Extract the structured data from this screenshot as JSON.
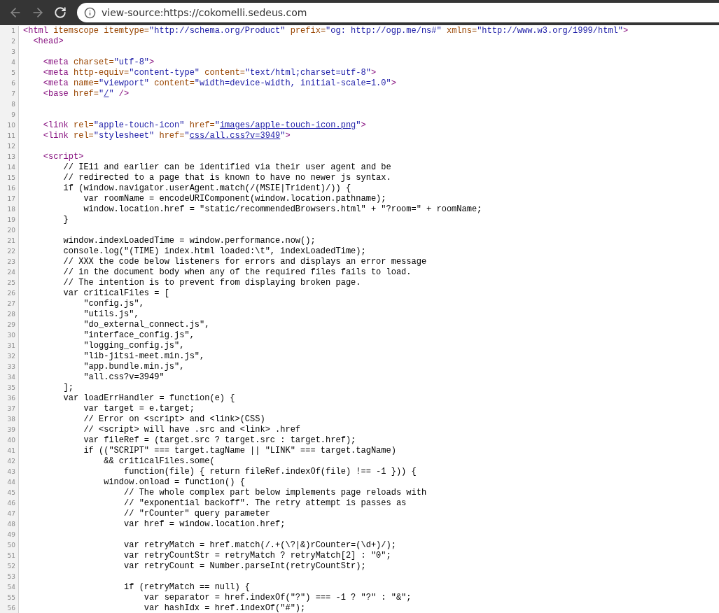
{
  "toolbar": {
    "back": {
      "disabled": true
    },
    "forward": {
      "disabled": true
    },
    "address_bar": {
      "value": "view-source:https://cokomelli.sedeus.com"
    }
  },
  "lines": [
    {
      "number": "1",
      "tokens": [
        {
          "kind": "tag",
          "text": "<html"
        },
        {
          "kind": "attr",
          "text": " itemscope itemtype="
        },
        {
          "kind": "value",
          "text": "\"http://schema.org/Product\""
        },
        {
          "kind": "attr",
          "text": " prefix="
        },
        {
          "kind": "value",
          "text": "\"og: http://ogp.me/ns#\""
        },
        {
          "kind": "attr",
          "text": " xmlns="
        },
        {
          "kind": "value",
          "text": "\"http://www.w3.org/1999/html\""
        },
        {
          "kind": "tag",
          "text": ">"
        }
      ]
    },
    {
      "number": "2",
      "tokens": [
        {
          "kind": "tag",
          "text": "  <head>"
        }
      ]
    },
    {
      "number": "3"
    },
    {
      "number": "4",
      "tokens": [
        {
          "kind": "tag",
          "text": "    <meta"
        },
        {
          "kind": "attr",
          "text": " charset="
        },
        {
          "kind": "value",
          "text": "\"utf-8\""
        },
        {
          "kind": "tag",
          "text": ">"
        }
      ]
    },
    {
      "number": "5",
      "tokens": [
        {
          "kind": "tag",
          "text": "    <meta"
        },
        {
          "kind": "attr",
          "text": " http-equiv="
        },
        {
          "kind": "value",
          "text": "\"content-type\""
        },
        {
          "kind": "attr",
          "text": " content="
        },
        {
          "kind": "value",
          "text": "\"text/html;charset=utf-8\""
        },
        {
          "kind": "tag",
          "text": ">"
        }
      ]
    },
    {
      "number": "6",
      "tokens": [
        {
          "kind": "tag",
          "text": "    <meta"
        },
        {
          "kind": "attr",
          "text": " name="
        },
        {
          "kind": "value",
          "text": "\"viewport\""
        },
        {
          "kind": "attr",
          "text": " content="
        },
        {
          "kind": "value",
          "text": "\"width=device-width, initial-scale=1.0\""
        },
        {
          "kind": "tag",
          "text": ">"
        }
      ]
    },
    {
      "number": "7",
      "tokens": [
        {
          "kind": "tag",
          "text": "    <base"
        },
        {
          "kind": "attr",
          "text": " href="
        },
        {
          "kind": "value",
          "text": "\""
        },
        {
          "kind": "link",
          "text": "/"
        },
        {
          "kind": "value",
          "text": "\""
        },
        {
          "kind": "tag",
          "text": " />"
        }
      ]
    },
    {
      "number": "8"
    },
    {
      "number": "9"
    },
    {
      "number": "10",
      "tokens": [
        {
          "kind": "tag",
          "text": "    <link"
        },
        {
          "kind": "attr",
          "text": " rel="
        },
        {
          "kind": "value",
          "text": "\"apple-touch-icon\""
        },
        {
          "kind": "attr",
          "text": " href="
        },
        {
          "kind": "value",
          "text": "\""
        },
        {
          "kind": "link",
          "text": "images/apple-touch-icon.png"
        },
        {
          "kind": "value",
          "text": "\""
        },
        {
          "kind": "tag",
          "text": ">"
        }
      ]
    },
    {
      "number": "11",
      "tokens": [
        {
          "kind": "tag",
          "text": "    <link"
        },
        {
          "kind": "attr",
          "text": " rel="
        },
        {
          "kind": "value",
          "text": "\"stylesheet\""
        },
        {
          "kind": "attr",
          "text": " href="
        },
        {
          "kind": "value",
          "text": "\""
        },
        {
          "kind": "link",
          "text": "css/all.css?v=3949"
        },
        {
          "kind": "value",
          "text": "\""
        },
        {
          "kind": "tag",
          "text": ">"
        }
      ]
    },
    {
      "number": "12"
    },
    {
      "number": "13",
      "tokens": [
        {
          "kind": "tag",
          "text": "    <script>"
        }
      ]
    },
    {
      "number": "14",
      "tokens": [
        {
          "kind": "text",
          "text": "        // IE11 and earlier can be identified via their user agent and be"
        }
      ]
    },
    {
      "number": "15",
      "tokens": [
        {
          "kind": "text",
          "text": "        // redirected to a page that is known to have no newer js syntax."
        }
      ]
    },
    {
      "number": "16",
      "tokens": [
        {
          "kind": "text",
          "text": "        if (window.navigator.userAgent.match(/(MSIE|Trident)/)) {"
        }
      ]
    },
    {
      "number": "17",
      "tokens": [
        {
          "kind": "text",
          "text": "            var roomName = encodeURIComponent(window.location.pathname);"
        }
      ]
    },
    {
      "number": "18",
      "tokens": [
        {
          "kind": "text",
          "text": "            window.location.href = \"static/recommendedBrowsers.html\" + \"?room=\" + roomName;"
        }
      ]
    },
    {
      "number": "19",
      "tokens": [
        {
          "kind": "text",
          "text": "        }"
        }
      ]
    },
    {
      "number": "20"
    },
    {
      "number": "21",
      "tokens": [
        {
          "kind": "text",
          "text": "        window.indexLoadedTime = window.performance.now();"
        }
      ]
    },
    {
      "number": "22",
      "tokens": [
        {
          "kind": "text",
          "text": "        console.log(\"(TIME) index.html loaded:\\t\", indexLoadedTime);"
        }
      ]
    },
    {
      "number": "23",
      "tokens": [
        {
          "kind": "text",
          "text": "        // XXX the code below listeners for errors and displays an error message"
        }
      ]
    },
    {
      "number": "24",
      "tokens": [
        {
          "kind": "text",
          "text": "        // in the document body when any of the required files fails to load."
        }
      ]
    },
    {
      "number": "25",
      "tokens": [
        {
          "kind": "text",
          "text": "        // The intention is to prevent from displaying broken page."
        }
      ]
    },
    {
      "number": "26",
      "tokens": [
        {
          "kind": "text",
          "text": "        var criticalFiles = ["
        }
      ]
    },
    {
      "number": "27",
      "tokens": [
        {
          "kind": "text",
          "text": "            \"config.js\","
        }
      ]
    },
    {
      "number": "28",
      "tokens": [
        {
          "kind": "text",
          "text": "            \"utils.js\","
        }
      ]
    },
    {
      "number": "29",
      "tokens": [
        {
          "kind": "text",
          "text": "            \"do_external_connect.js\","
        }
      ]
    },
    {
      "number": "30",
      "tokens": [
        {
          "kind": "text",
          "text": "            \"interface_config.js\","
        }
      ]
    },
    {
      "number": "31",
      "tokens": [
        {
          "kind": "text",
          "text": "            \"logging_config.js\","
        }
      ]
    },
    {
      "number": "32",
      "tokens": [
        {
          "kind": "text",
          "text": "            \"lib-jitsi-meet.min.js\","
        }
      ]
    },
    {
      "number": "33",
      "tokens": [
        {
          "kind": "text",
          "text": "            \"app.bundle.min.js\","
        }
      ]
    },
    {
      "number": "34",
      "tokens": [
        {
          "kind": "text",
          "text": "            \"all.css?v=3949\""
        }
      ]
    },
    {
      "number": "35",
      "tokens": [
        {
          "kind": "text",
          "text": "        ];"
        }
      ]
    },
    {
      "number": "36",
      "tokens": [
        {
          "kind": "text",
          "text": "        var loadErrHandler = function(e) {"
        }
      ]
    },
    {
      "number": "37",
      "tokens": [
        {
          "kind": "text",
          "text": "            var target = e.target;"
        }
      ]
    },
    {
      "number": "38",
      "tokens": [
        {
          "kind": "text",
          "text": "            // Error on <script> and <link>(CSS)"
        }
      ]
    },
    {
      "number": "39",
      "tokens": [
        {
          "kind": "text",
          "text": "            // <script> will have .src and <link> .href"
        }
      ]
    },
    {
      "number": "40",
      "tokens": [
        {
          "kind": "text",
          "text": "            var fileRef = (target.src ? target.src : target.href);"
        }
      ]
    },
    {
      "number": "41",
      "tokens": [
        {
          "kind": "text",
          "text": "            if ((\"SCRIPT\" === target.tagName || \"LINK\" === target.tagName)"
        }
      ]
    },
    {
      "number": "42",
      "tokens": [
        {
          "kind": "text",
          "text": "                && criticalFiles.some("
        }
      ]
    },
    {
      "number": "43",
      "tokens": [
        {
          "kind": "text",
          "text": "                    function(file) { return fileRef.indexOf(file) !== -1 })) {"
        }
      ]
    },
    {
      "number": "44",
      "tokens": [
        {
          "kind": "text",
          "text": "                window.onload = function() {"
        }
      ]
    },
    {
      "number": "45",
      "tokens": [
        {
          "kind": "text",
          "text": "                    // The whole complex part below implements page reloads with"
        }
      ]
    },
    {
      "number": "46",
      "tokens": [
        {
          "kind": "text",
          "text": "                    // \"exponential backoff\". The retry attempt is passes as"
        }
      ]
    },
    {
      "number": "47",
      "tokens": [
        {
          "kind": "text",
          "text": "                    // \"rCounter\" query parameter"
        }
      ]
    },
    {
      "number": "48",
      "tokens": [
        {
          "kind": "text",
          "text": "                    var href = window.location.href;"
        }
      ]
    },
    {
      "number": "49"
    },
    {
      "number": "50",
      "tokens": [
        {
          "kind": "text",
          "text": "                    var retryMatch = href.match(/.+(\\?|&)rCounter=(\\d+)/);"
        }
      ]
    },
    {
      "number": "51",
      "tokens": [
        {
          "kind": "text",
          "text": "                    var retryCountStr = retryMatch ? retryMatch[2] : \"0\";"
        }
      ]
    },
    {
      "number": "52",
      "tokens": [
        {
          "kind": "text",
          "text": "                    var retryCount = Number.parseInt(retryCountStr);"
        }
      ]
    },
    {
      "number": "53"
    },
    {
      "number": "54",
      "tokens": [
        {
          "kind": "text",
          "text": "                    if (retryMatch == null) {"
        }
      ]
    },
    {
      "number": "55",
      "tokens": [
        {
          "kind": "text",
          "text": "                        var separator = href.indexOf(\"?\") === -1 ? \"?\" : \"&\";"
        }
      ]
    },
    {
      "number": "56",
      "tokens": [
        {
          "kind": "text",
          "text": "                        var hashIdx = href.indexOf(\"#\");"
        }
      ]
    }
  ]
}
